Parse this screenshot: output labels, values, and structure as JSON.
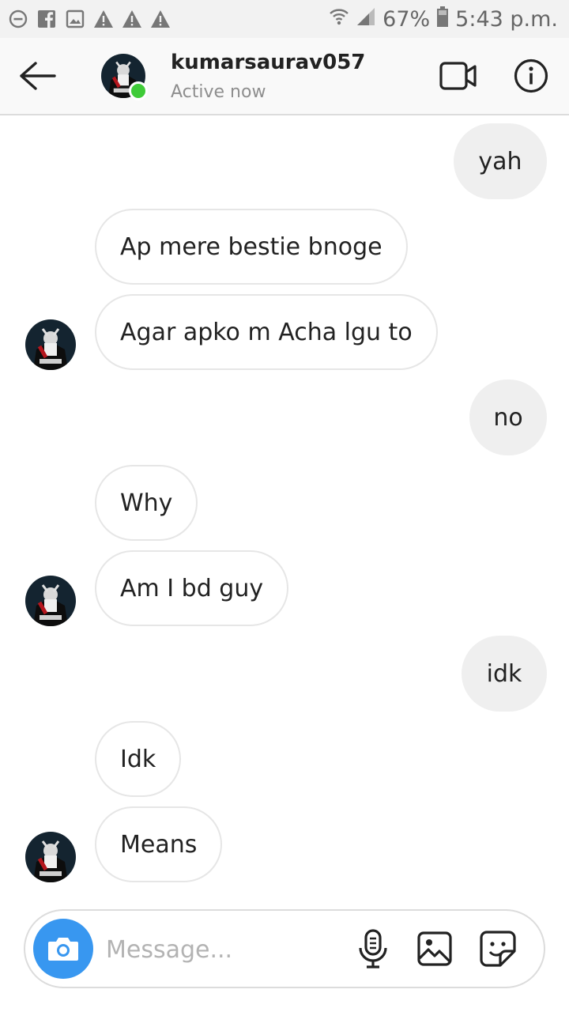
{
  "status_bar": {
    "battery": "67%",
    "time": "5:43 p.m.",
    "left_icons": [
      "minus-circle-icon",
      "facebook-icon",
      "image-icon",
      "warning-icon",
      "warning-icon",
      "warning-icon"
    ],
    "right_icons": [
      "wifi-icon",
      "signal-icon",
      "battery-icon"
    ]
  },
  "header": {
    "username": "kumarsaurav057",
    "status": "Active now",
    "online_color": "#3fcb38"
  },
  "messages": [
    {
      "side": "out",
      "text": "yah"
    },
    {
      "side": "in",
      "text": "Ap mere bestie bnoge"
    },
    {
      "side": "in",
      "text": "Agar apko m Acha lgu to",
      "avatar": true
    },
    {
      "side": "out",
      "text": "no"
    },
    {
      "side": "in",
      "text": "Why"
    },
    {
      "side": "in",
      "text": "Am I bd guy",
      "avatar": true
    },
    {
      "side": "out",
      "text": "idk"
    },
    {
      "side": "in",
      "text": "Idk"
    },
    {
      "side": "in",
      "text": "Means",
      "avatar": true
    }
  ],
  "composer": {
    "placeholder": "Message...",
    "accent": "#3897f0"
  }
}
